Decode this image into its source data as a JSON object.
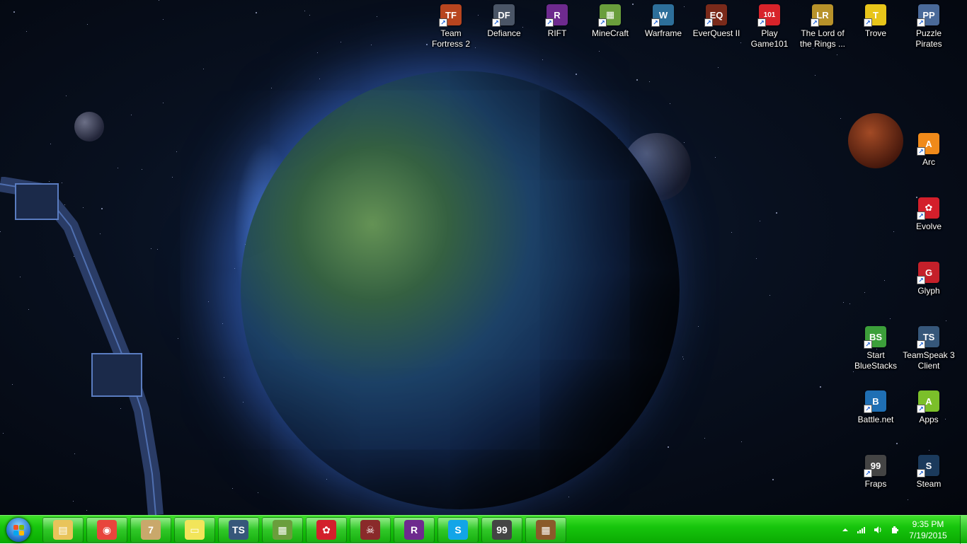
{
  "desktop_icons": [
    {
      "name": "Team Fortress 2",
      "label": "Team Fortress 2",
      "icon": "team-fortress-2-icon",
      "color": "#b8451f",
      "glyph": "TF"
    },
    {
      "name": "Defiance",
      "label": "Defiance",
      "icon": "defiance-icon",
      "color": "#4a5566",
      "glyph": "DF"
    },
    {
      "name": "RIFT",
      "label": "RIFT",
      "icon": "rift-icon",
      "color": "#6e2a8e",
      "glyph": "R"
    },
    {
      "name": "MineCraft",
      "label": "MineCraft",
      "icon": "minecraft-icon",
      "color": "#6a9e3c",
      "glyph": "▦"
    },
    {
      "name": "Warframe",
      "label": "Warframe",
      "icon": "warframe-icon",
      "color": "#2d6f9a",
      "glyph": "W"
    },
    {
      "name": "EverQuest II",
      "label": "EverQuest II",
      "icon": "everquest-ii-icon",
      "color": "#7a2a1a",
      "glyph": "EQ"
    },
    {
      "name": "Play Game101",
      "label": "Play Game101",
      "icon": "game101-icon",
      "color": "#d8232a",
      "glyph": "101"
    },
    {
      "name": "The Lord of the Rings",
      "label": "The Lord of the Rings ...",
      "icon": "lord-of-the-rings-icon",
      "color": "#b8922a",
      "glyph": "LR"
    },
    {
      "name": "Trove",
      "label": "Trove",
      "icon": "trove-icon",
      "color": "#e8c51a",
      "glyph": "T"
    },
    {
      "name": "Puzzle Pirates",
      "label": "Puzzle Pirates",
      "icon": "puzzle-pirates-icon",
      "color": "#4a6a9a",
      "glyph": "PP"
    },
    {
      "name": "Arc",
      "label": "Arc",
      "icon": "arc-icon",
      "color": "#f08a1a",
      "glyph": "A"
    },
    {
      "name": "Evolve",
      "label": "Evolve",
      "icon": "evolve-icon",
      "color": "#d31f2b",
      "glyph": "✿"
    },
    {
      "name": "Glyph",
      "label": "Glyph",
      "icon": "glyph-icon",
      "color": "#c4202a",
      "glyph": "G"
    },
    {
      "name": "Start BlueStacks",
      "label": "Start BlueStacks",
      "icon": "bluestacks-icon",
      "color": "#3c9f3a",
      "glyph": "BS"
    },
    {
      "name": "TeamSpeak 3 Client",
      "label": "TeamSpeak 3 Client",
      "icon": "teamspeak-icon",
      "color": "#36577a",
      "glyph": "TS"
    },
    {
      "name": "Battle.net",
      "label": "Battle.net",
      "icon": "battle-net-icon",
      "color": "#1f6fb4",
      "glyph": "B"
    },
    {
      "name": "Apps",
      "label": "Apps",
      "icon": "android-apps-icon",
      "color": "#7bbf2a",
      "glyph": "A"
    },
    {
      "name": "Fraps",
      "label": "Fraps",
      "icon": "fraps-icon",
      "color": "#444444",
      "glyph": "99"
    },
    {
      "name": "Steam",
      "label": "Steam",
      "icon": "steam-icon",
      "color": "#1b3a5c",
      "glyph": "S"
    }
  ],
  "taskbar": {
    "start": {
      "icon": "windows-start-icon"
    },
    "pinned": [
      {
        "name": "windows-explorer",
        "icon": "folder-icon",
        "color": "#e9c45a",
        "glyph": "▤"
      },
      {
        "name": "google-chrome",
        "icon": "chrome-icon",
        "color": "#e8453c",
        "glyph": "◉"
      },
      {
        "name": "seven-app",
        "icon": "seven-icon",
        "color": "#c9a86b",
        "glyph": "7"
      },
      {
        "name": "sticky-notes",
        "icon": "sticky-notes-icon",
        "color": "#f2e55a",
        "glyph": "▭"
      },
      {
        "name": "teamspeak",
        "icon": "teamspeak-icon",
        "color": "#36577a",
        "glyph": "TS"
      },
      {
        "name": "minecraft",
        "icon": "minecraft-icon",
        "color": "#6a9e3c",
        "glyph": "▦"
      },
      {
        "name": "evolve",
        "icon": "evolve-icon",
        "color": "#d31f2b",
        "glyph": "✿"
      },
      {
        "name": "puzzle-pirates",
        "icon": "puzzle-pirates-icon",
        "color": "#8a2a2a",
        "glyph": "☠"
      },
      {
        "name": "rift",
        "icon": "rift-icon",
        "color": "#6e2a8e",
        "glyph": "R"
      },
      {
        "name": "skype",
        "icon": "skype-icon",
        "color": "#12a5e8",
        "glyph": "S"
      },
      {
        "name": "fraps",
        "icon": "fraps-icon",
        "color": "#444444",
        "glyph": "99"
      },
      {
        "name": "minecraft-launcher",
        "icon": "crafting-table-icon",
        "color": "#8a5a2a",
        "glyph": "▦"
      }
    ],
    "tray": {
      "icons": [
        "show-hidden-icons-arrow",
        "network-signal-icon",
        "volume-icon",
        "power-icon"
      ],
      "time": "9:35 PM",
      "date": "7/19/2015"
    }
  }
}
